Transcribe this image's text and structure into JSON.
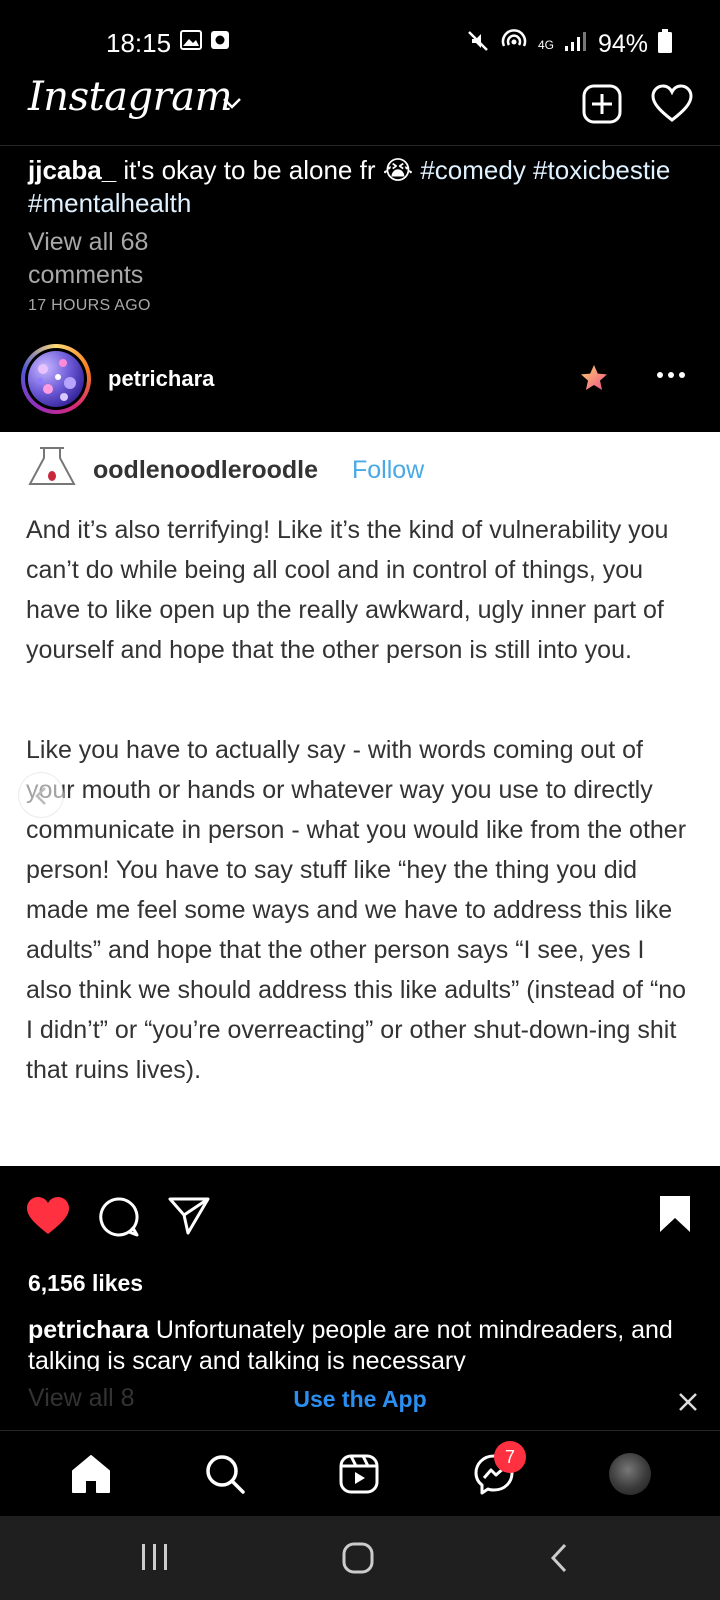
{
  "status_bar": {
    "time": "18:15",
    "battery": "94%",
    "network": "4G",
    "icons": [
      "gallery-icon",
      "screen-record-icon",
      "mute-icon",
      "hotspot-icon",
      "signal-icon",
      "battery-icon"
    ]
  },
  "header": {
    "logo": "Instagram",
    "icons": [
      "chevron-down-icon",
      "new-post-icon",
      "heart-icon"
    ]
  },
  "previous_post": {
    "username": "jjcaba_",
    "caption_text": " it's okay to be alone fr 😭 ",
    "hashtags": "#comedy #toxicbestie #mentalhealth",
    "view_comments": "View all 68 comments",
    "timestamp": "17 HOURS AGO"
  },
  "post": {
    "username": "petrichara",
    "icons": [
      "favorite-star-icon",
      "more-options-icon"
    ],
    "image": {
      "author": "oodlenoodleroodle",
      "follow": "Follow",
      "paragraph1": "And it’s also terrifying! Like it’s the kind of vulnerability you can’t do while being all cool and in control of things, you have to like open up the really awkward, ugly inner part of yourself and hope that the other person is still into you.",
      "paragraph2": "Like you have to actually say - with words coming out of your mouth or hands or whatever way you use to directly communicate in person - what you would like from the other person! You have to say stuff like “hey the thing you did made me feel some ways and we have to address this like adults” and hope that the other person says “I see, yes I also think we should address this like adults” (instead of “no I didn’t” or “you’re overreacting” or other shut-down-ing shit that ruins lives)."
    },
    "likes": "6,156 likes",
    "caption_user": "petrichara",
    "caption_text": " Unfortunately people are not mindreaders, and talking is scary and talking is necessary",
    "view_comments_partial": "View all 8"
  },
  "banner": {
    "link": "Use the App"
  },
  "bottom_nav": {
    "items": [
      "home-icon",
      "search-icon",
      "reels-icon",
      "messenger-icon",
      "profile-avatar"
    ],
    "messenger_badge": "7"
  },
  "colors": {
    "like_red": "#ff3040",
    "link_blue": "#2a8ff0",
    "follow_blue": "#48a9e6",
    "background": "#000000"
  }
}
